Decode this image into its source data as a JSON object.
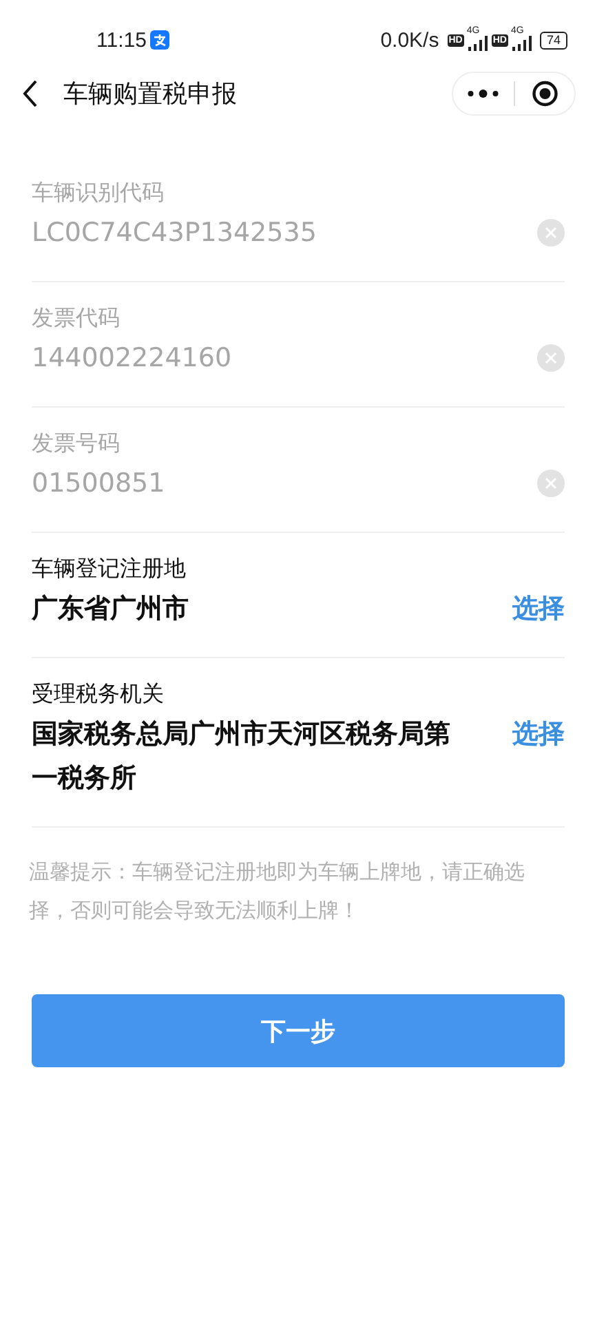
{
  "status_bar": {
    "time": "11:15",
    "net_speed": "0.0K/s",
    "sims": [
      {
        "hd": "HD",
        "network": "4G"
      },
      {
        "hd": "HD",
        "network": "4G"
      }
    ],
    "battery": "74"
  },
  "nav_bar": {
    "title": "车辆购置税申报"
  },
  "fields": [
    {
      "kind": "input",
      "label": "车辆识别代码",
      "value": "LC0C74C43P1342535",
      "disabled": true
    },
    {
      "kind": "input",
      "label": "发票代码",
      "value": "144002224160",
      "disabled": true
    },
    {
      "kind": "input",
      "label": "发票号码",
      "value": "01500851",
      "disabled": true
    },
    {
      "kind": "select",
      "label": "车辆登记注册地",
      "value": "广东省广州市",
      "action": "选择"
    },
    {
      "kind": "select",
      "label": "受理税务机关",
      "value": "国家税务总局广州市天河区税务局第一税务所",
      "action": "选择"
    }
  ],
  "notice": "温馨提示：车辆登记注册地即为车辆上牌地，请正确选择，否则可能会导致无法顺利上牌！",
  "next_button": "下一步"
}
